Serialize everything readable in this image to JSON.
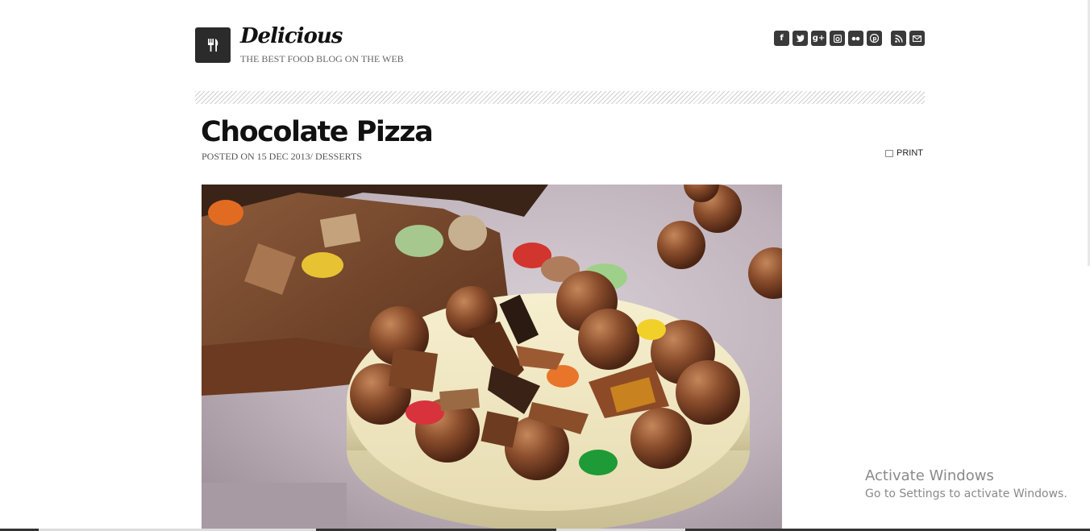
{
  "site": {
    "title": "Delicious",
    "tagline": "THE BEST FOOD BLOG ON THE WEB",
    "logo_icon": "fork-knife-icon"
  },
  "social": [
    {
      "name": "facebook-icon",
      "glyph": "f"
    },
    {
      "name": "twitter-icon",
      "glyph": "t"
    },
    {
      "name": "google-plus-icon",
      "glyph": "g+"
    },
    {
      "name": "instagram-icon",
      "glyph": "◙"
    },
    {
      "name": "flickr-icon",
      "glyph": "••"
    },
    {
      "name": "pinterest-icon",
      "glyph": "P"
    },
    {
      "name": "rss-icon",
      "glyph": "≀"
    },
    {
      "name": "email-icon",
      "glyph": "✉"
    }
  ],
  "post": {
    "title": "Chocolate Pizza",
    "meta": "POSTED ON 15 DEC 2013/ DESSERTS",
    "print_label": "PRINT"
  },
  "watermark": {
    "title": "Activate Windows",
    "subtitle": "Go to Settings to activate Windows."
  },
  "colors": {
    "icon_bg": "#3a3a3a",
    "logo_bg": "#2b2b2b"
  }
}
